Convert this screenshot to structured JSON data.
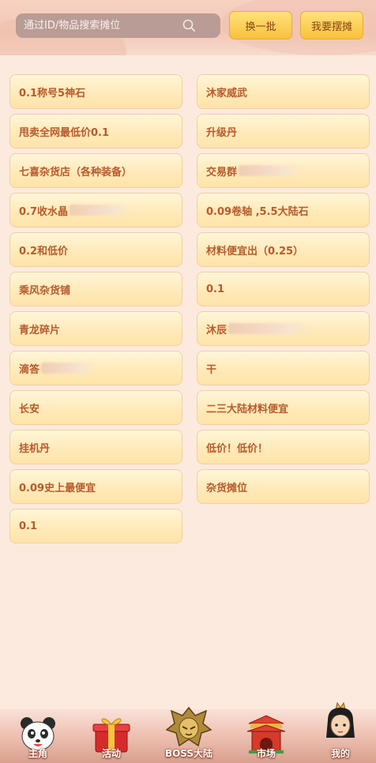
{
  "header": {
    "search_placeholder": "通过ID/物品搜索摊位",
    "refresh_label": "换一批",
    "stall_label": "我要摆摊"
  },
  "stalls": {
    "left": [
      {
        "name": "0.1称号5神石",
        "blurred": false
      },
      {
        "name": "甩卖全网最低价0.1",
        "blurred": false
      },
      {
        "name": "七喜杂货店（各种装备）",
        "blurred": false
      },
      {
        "name": "0.7收水晶",
        "blurred": true
      },
      {
        "name": "0.2和低价",
        "blurred": false
      },
      {
        "name": "乘风杂货铺",
        "blurred": false
      },
      {
        "name": "青龙碎片",
        "blurred": false
      },
      {
        "name": "滴答",
        "blurred": true
      },
      {
        "name": "长安",
        "blurred": false
      },
      {
        "name": "挂机丹",
        "blurred": false
      },
      {
        "name": "0.09史上最便宜",
        "blurred": false
      },
      {
        "name": "0.1",
        "blurred": false
      }
    ],
    "right": [
      {
        "name": "沐家威武",
        "blurred": false
      },
      {
        "name": "升级丹",
        "blurred": false
      },
      {
        "name": "交易群",
        "blurred": true
      },
      {
        "name": "0.09卷轴 ,5.5大陆石",
        "blurred": false
      },
      {
        "name": "材料便宜出（0.25）",
        "blurred": false
      },
      {
        "name": "0.1",
        "blurred": false
      },
      {
        "name": "沐辰",
        "blurred": true
      },
      {
        "name": "干",
        "blurred": false
      },
      {
        "name": "二三大陆材料便宜",
        "blurred": false
      },
      {
        "name": "低价！低价！",
        "blurred": false
      },
      {
        "name": "杂货摊位",
        "blurred": false
      }
    ]
  },
  "tabs": [
    {
      "label": "主角",
      "icon": "panda-icon"
    },
    {
      "label": "活动",
      "icon": "gift-box-icon"
    },
    {
      "label": "BOSS大陆",
      "icon": "boss-helmet-icon"
    },
    {
      "label": "市场",
      "icon": "market-gate-icon"
    },
    {
      "label": "我的",
      "icon": "character-avatar-icon"
    }
  ],
  "colors": {
    "card_text": "#b75a2c",
    "button_gold": "#f8c13e",
    "background": "#fdeadf"
  }
}
